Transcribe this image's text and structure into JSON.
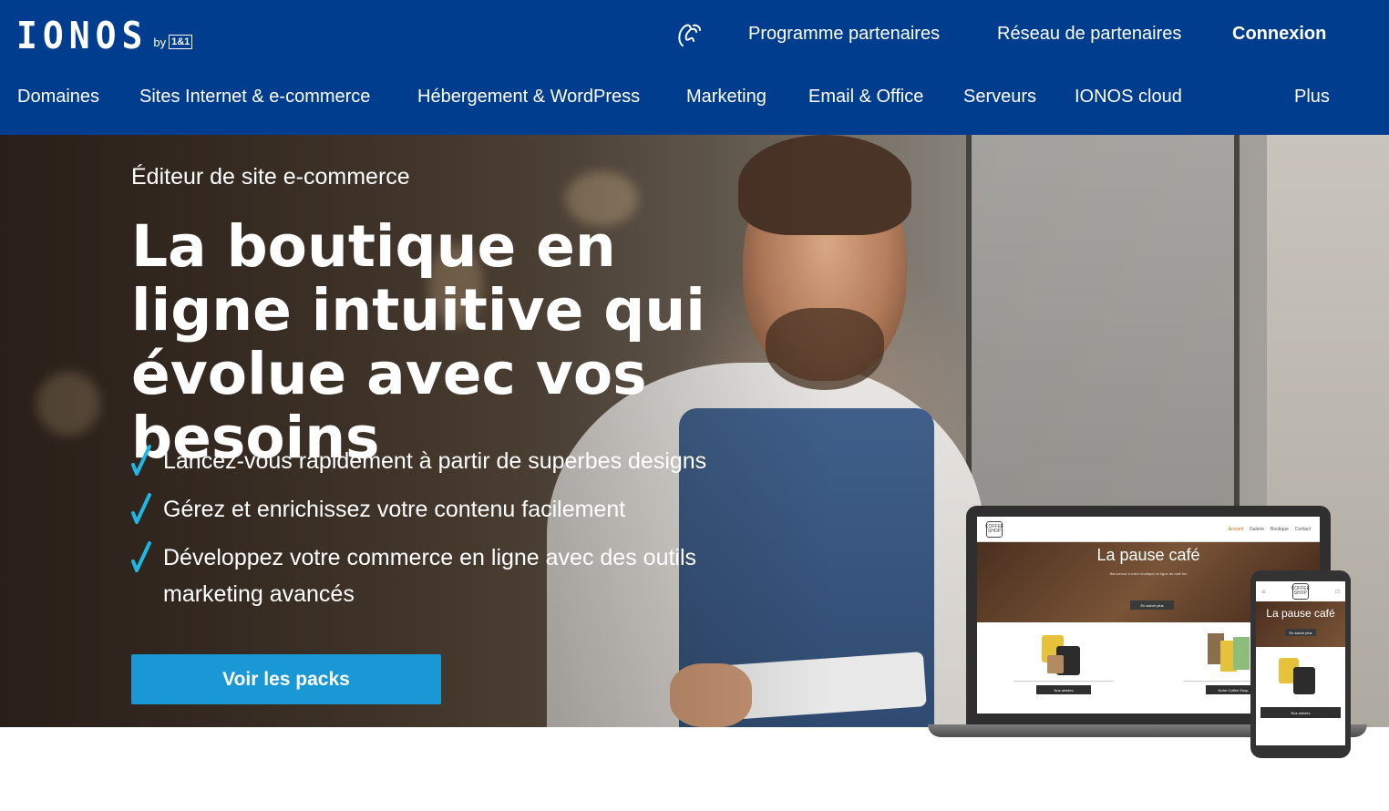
{
  "header": {
    "logo_text": "IONOS",
    "logo_by": "by",
    "logo_partner": "1&1",
    "top_links": [
      "Programme partenaires",
      "Réseau de partenaires"
    ],
    "login_label": "Connexion"
  },
  "nav": {
    "items": [
      "Domaines",
      "Sites Internet & e-commerce",
      "Hébergement & WordPress",
      "Marketing",
      "Email & Office",
      "Serveurs",
      "IONOS cloud"
    ],
    "more_label": "Plus"
  },
  "hero": {
    "eyebrow": "Éditeur de site e-commerce",
    "headline": "La boutique en ligne intuitive qui évolue avec vos besoins",
    "features": [
      "Lancez-vous rapidement à partir de superbes designs",
      "Gérez et enrichissez votre contenu facilement",
      "Développez votre commerce en ligne avec des outils marketing avancés"
    ],
    "cta_label": "Voir les packs"
  },
  "device_mockup": {
    "logo_text": "COFFEE SHOP",
    "menu": [
      "Accueil",
      "Galerie",
      "Boutique",
      "Contact"
    ],
    "title": "La pause café",
    "intro": "Bienvenue à notre boutique en ligne de café bio",
    "more_label": "En savoir plus",
    "product_buttons": [
      "Nos articles",
      "Notre Coffee Shop"
    ]
  },
  "colors": {
    "header_bg": "#003d8f",
    "cta_bg": "#1a98d5",
    "check_color": "#1fb7e6"
  }
}
